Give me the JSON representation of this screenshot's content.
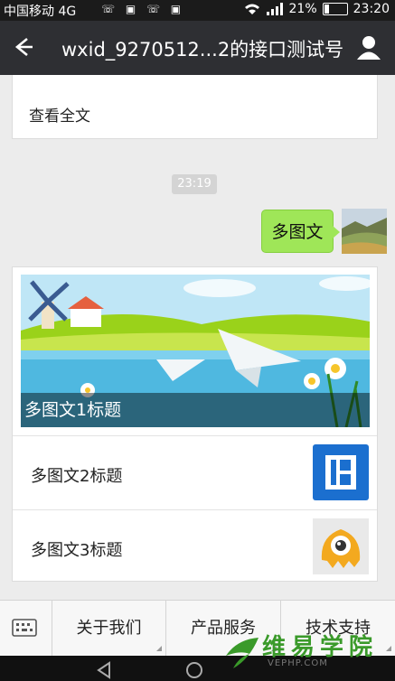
{
  "status_bar": {
    "carrier": "中国移动 4G",
    "battery": "21%",
    "battery_level": 0.21,
    "time": "23:20",
    "network": "4G"
  },
  "title_bar": {
    "title": "wxid_9270512...2的接口测试号"
  },
  "chat": {
    "previous_card_link": "查看全文",
    "timestamp": "23:19",
    "sent_message": "多图文",
    "news_card": {
      "banner_title": "多图文1标题",
      "items": [
        {
          "title": "多图文2标题",
          "thumb_icon": "film-icon"
        },
        {
          "title": "多图文3标题",
          "thumb_icon": "monster-icon"
        }
      ]
    }
  },
  "menu_bar": {
    "items": [
      "关于我们",
      "产品服务",
      "技术支持"
    ]
  },
  "watermark": {
    "cn": "维易学院",
    "en": "VEPHP.COM"
  },
  "colors": {
    "title_bar_bg": "#2e2f33",
    "bubble_green": "#9fe658",
    "thumb_blue": "#1b6fcf",
    "chat_bg": "#ececec"
  }
}
